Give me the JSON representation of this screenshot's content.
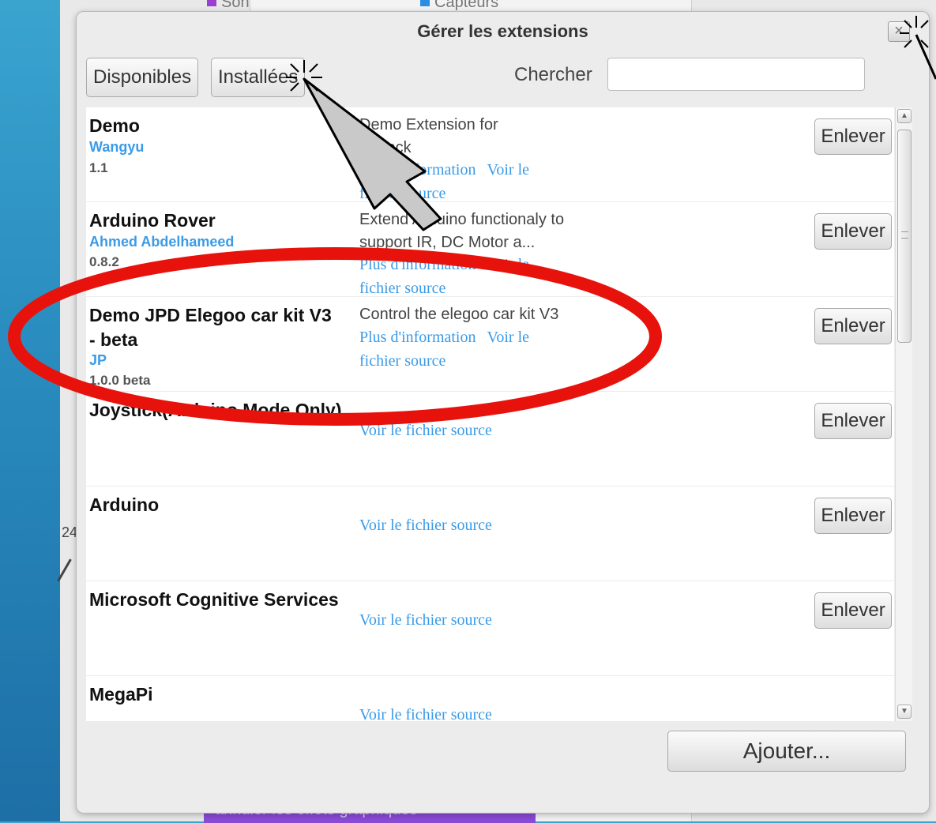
{
  "background": {
    "category_son": "Son",
    "category_capteurs": "Capteurs",
    "category_son_color": "#9a3fd0",
    "category_capteurs_color": "#2b8ee3",
    "side_value": "24",
    "bottom_block": "annuler les effets graphiques"
  },
  "dialog": {
    "title": "Gérer les extensions",
    "close_label": "×",
    "tabs": [
      "Disponibles",
      "Installées"
    ],
    "search_label": "Chercher",
    "search_value": "",
    "add_button": "Ajouter..."
  },
  "extensions": [
    {
      "name": "Demo",
      "author": "Wangyu",
      "version": "1.1",
      "description_1": "Demo Extension for",
      "description_2": "mBlock",
      "link_more_1": "Plus d'information",
      "link_source": "Voir le",
      "link_source_2": "fichier source",
      "remove": "Enlever"
    },
    {
      "name": "Arduino Rover",
      "author": "Ahmed Abdelhameed",
      "version": "0.8.2",
      "description_1": "Extend Arduino functionaly to",
      "description_2": "support IR, DC Motor a...",
      "link_more_1": "Plus d'information",
      "link_source": "Voir le",
      "link_source_2": "fichier source",
      "remove": "Enlever"
    },
    {
      "name": "Demo JPD Elegoo car kit V3 - beta",
      "author": "JP",
      "version": "1.0.0 beta",
      "description_1": "Control the elegoo car kit V3",
      "link_more_1": "Plus d'information",
      "link_source": "Voir le",
      "link_source_2": "fichier source",
      "remove": "Enlever"
    },
    {
      "name": "Joystick(Arduino Mode Only)",
      "link_source_full": "Voir le fichier source",
      "remove": "Enlever"
    },
    {
      "name": "Arduino",
      "link_source_full": "Voir le fichier source",
      "remove": "Enlever"
    },
    {
      "name": "Microsoft Cognitive Services",
      "link_source_full": "Voir le fichier source",
      "remove": "Enlever"
    },
    {
      "name": "MegaPi",
      "link_source_full": "Voir le fichier source"
    }
  ],
  "annotation": {
    "highlight_color": "#e8120c",
    "cursor_color": "#c9c9c9"
  }
}
